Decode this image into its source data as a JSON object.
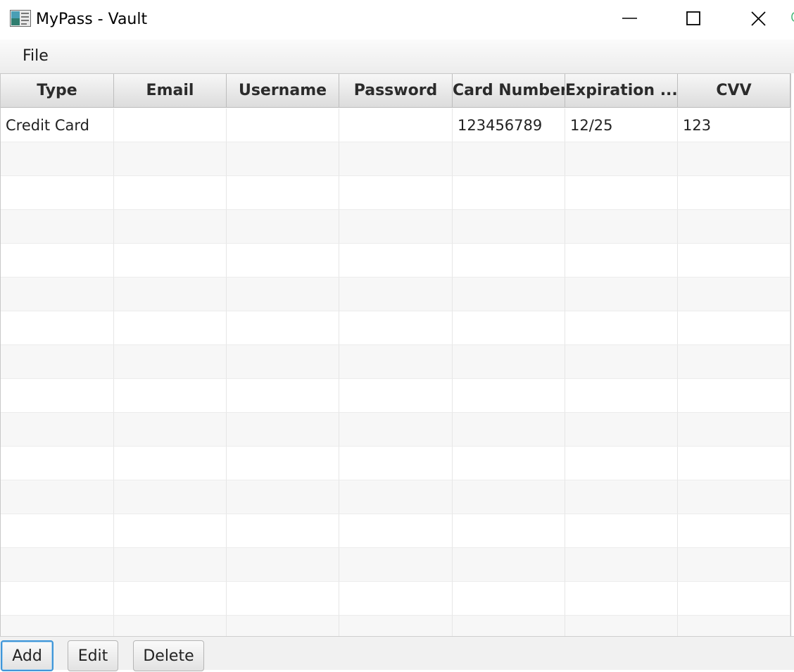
{
  "window": {
    "title": "MyPass - Vault",
    "app_icon": "app-icon",
    "controls": [
      "minimize-icon",
      "maximize-icon",
      "close-icon"
    ]
  },
  "menu": {
    "file_label": "File"
  },
  "table": {
    "columns": [
      "Type",
      "Email",
      "Username",
      "Password",
      "Card Number",
      "Expiration ...",
      "CVV"
    ],
    "rows": [
      [
        "Credit Card",
        "",
        "",
        "",
        "123456789",
        "12/25",
        "123"
      ]
    ]
  },
  "buttons": {
    "add_label": "Add",
    "edit_label": "Edit",
    "delete_label": "Delete"
  },
  "colors": {
    "focus_border": "#3f96d8",
    "header_bg": "#e6e6e6",
    "alt_row_bg": "#f7f7f7"
  }
}
